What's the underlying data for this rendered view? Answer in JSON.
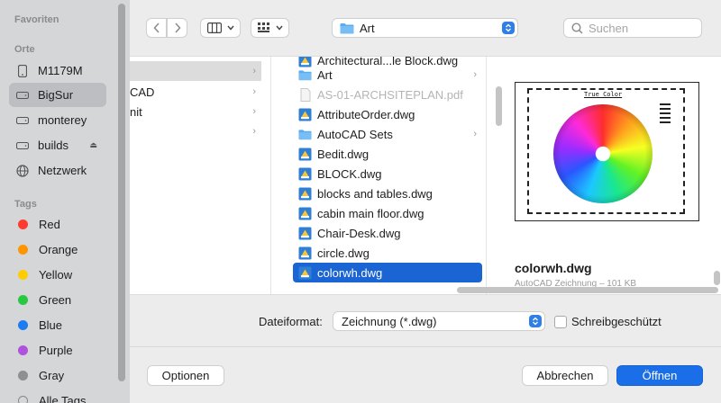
{
  "sidebar": {
    "favorites_title": "Favoriten",
    "locations_title": "Orte",
    "locations": [
      {
        "label": "M1179M",
        "icon": "drive-icon"
      },
      {
        "label": "BigSur",
        "icon": "drive-icon",
        "selected": true
      },
      {
        "label": "monterey",
        "icon": "drive-icon"
      },
      {
        "label": "builds",
        "icon": "drive-icon",
        "eject": true
      },
      {
        "label": "Netzwerk",
        "icon": "network-icon"
      }
    ],
    "tags_title": "Tags",
    "tags": [
      {
        "label": "Red",
        "color": "#ff3b30"
      },
      {
        "label": "Orange",
        "color": "#ff9500"
      },
      {
        "label": "Yellow",
        "color": "#ffcc00"
      },
      {
        "label": "Green",
        "color": "#28c840"
      },
      {
        "label": "Blue",
        "color": "#1e7cf2"
      },
      {
        "label": "Purple",
        "color": "#af52de"
      },
      {
        "label": "Gray",
        "color": "#8e8e93"
      },
      {
        "label": "Alle Tags",
        "color": ""
      }
    ]
  },
  "toolbar": {
    "back_icon": "chevron-left-icon",
    "forward_icon": "chevron-right-icon",
    "view_icon": "columns-view-icon",
    "group_icon": "grid-icon",
    "path_label": "Art",
    "search_placeholder": "Suchen"
  },
  "browser": {
    "col1_items": [
      {
        "label": "",
        "chevron": true,
        "highlight": true
      },
      {
        "label": "CAD",
        "chevron": true
      },
      {
        "label": "nit",
        "chevron": true
      },
      {
        "label": "",
        "chevron": true
      }
    ],
    "files": [
      {
        "label": "Architectural...le Block.dwg",
        "type": "dwg",
        "partial": true
      },
      {
        "label": "Art",
        "type": "folder",
        "chevron": true
      },
      {
        "label": "AS-01-ARCHSITEPLAN.pdf",
        "type": "pdf",
        "dim": true
      },
      {
        "label": "AttributeOrder.dwg",
        "type": "dwg"
      },
      {
        "label": "AutoCAD Sets",
        "type": "folder",
        "chevron": true
      },
      {
        "label": "Bedit.dwg",
        "type": "dwg"
      },
      {
        "label": "BLOCK.dwg",
        "type": "dwg"
      },
      {
        "label": "blocks and tables.dwg",
        "type": "dwg"
      },
      {
        "label": "cabin main floor.dwg",
        "type": "dwg"
      },
      {
        "label": "Chair-Desk.dwg",
        "type": "dwg"
      },
      {
        "label": "circle.dwg",
        "type": "dwg"
      },
      {
        "label": "colorwh.dwg",
        "type": "dwg",
        "selected": true
      }
    ],
    "preview": {
      "thumb_title": "True Color",
      "name": "colorwh.dwg",
      "subtitle": "AutoCAD Zeichnung – 101 KB"
    }
  },
  "footer": {
    "format_label": "Dateiformat:",
    "format_value": "Zeichnung (*.dwg)",
    "readonly_label": "Schreibgeschützt",
    "options_button": "Optionen",
    "cancel_button": "Abbrechen",
    "open_button": "Öffnen"
  }
}
